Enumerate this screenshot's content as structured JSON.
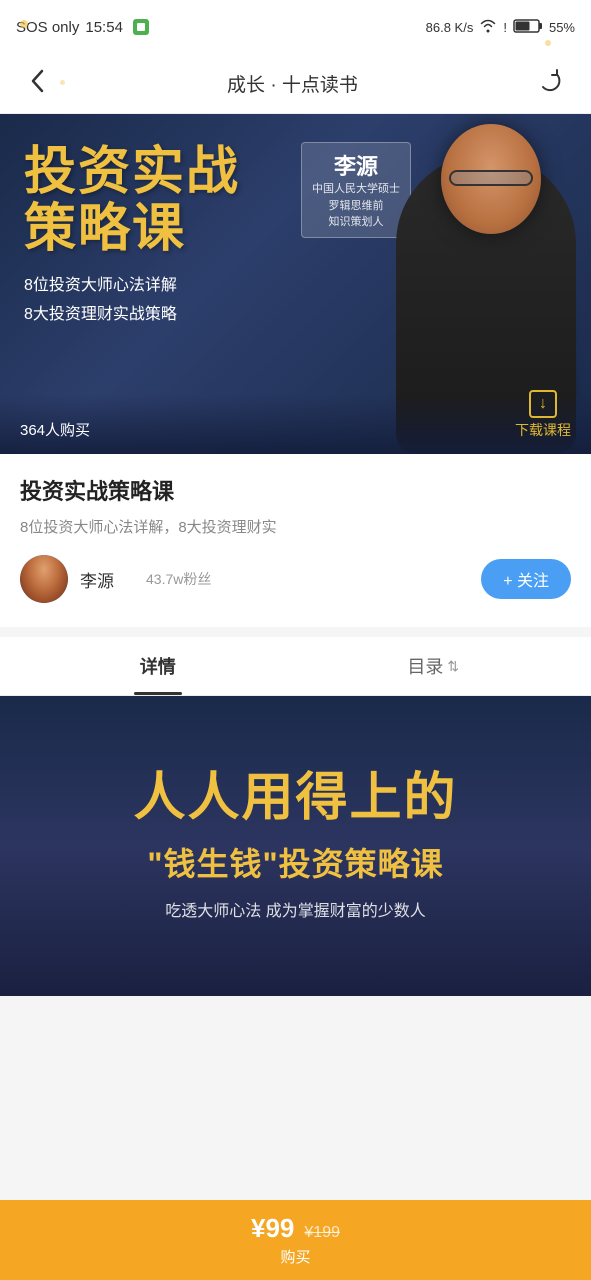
{
  "status_bar": {
    "signal": "SOS only",
    "time": "15:54",
    "network_speed": "86.8 K/s",
    "battery": "55%"
  },
  "nav": {
    "title": "成长 · 十点读书",
    "back_label": "‹",
    "refresh_label": "↺"
  },
  "hero": {
    "title_line1": "投资实战",
    "title_line2": "策略课",
    "person_name": "李源",
    "person_desc_line1": "罗辑思维前",
    "person_desc_line2": "知识策划人",
    "person_desc_line3": "中国人民大学硕士",
    "sub_text_line1": "8位投资大师心法详解",
    "sub_text_line2": "8大投资理财实战策略",
    "purchases": "364人购买",
    "download_label": "下载课程"
  },
  "course_info": {
    "title": "投资实战策略课",
    "desc": "8位投资大师心法详解，8大投资理财实",
    "author_name": "李源",
    "author_fans": "43.7w粉丝",
    "follow_btn": "+ 关注"
  },
  "tabs": {
    "detail_label": "详情",
    "catalog_label": "目录",
    "sort_icon": "⇅"
  },
  "promo": {
    "title_line1": "人人用得上的",
    "title_line2": "\"钱生钱\"投资策略课",
    "desc": "吃透大师心法 成为掌握财富的少数人"
  },
  "bottom_bar": {
    "price_current": "¥99",
    "price_original": "¥199",
    "buy_label": "购买"
  }
}
